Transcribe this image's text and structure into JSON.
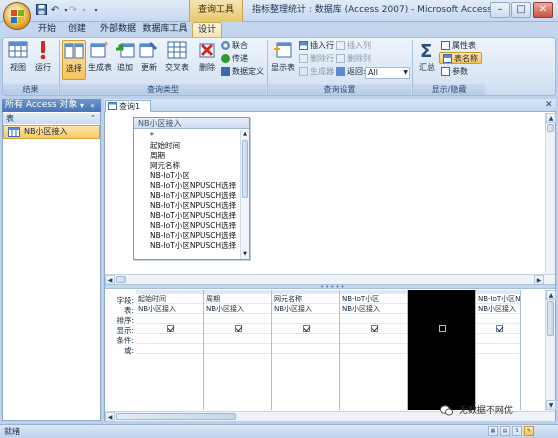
{
  "title_bar": {
    "context_tools": "查询工具",
    "window_title": "指标整理统计 : 数据库 (Access 2007) - Microsoft Access",
    "minimize": "–",
    "maximize": "□",
    "close": "✕"
  },
  "quick_access": {
    "save_icon": "save-icon",
    "undo_icon": "undo-icon",
    "redo_icon": "redo-icon"
  },
  "tabs": [
    {
      "label": "开始"
    },
    {
      "label": "创建"
    },
    {
      "label": "外部数据"
    },
    {
      "label": "数据库工具"
    },
    {
      "label": "设计"
    }
  ],
  "ribbon": {
    "groups": {
      "results": "结果",
      "query_type": "查询类型",
      "query_setup": "查询设置",
      "show_hide": "显示/隐藏"
    },
    "buttons": {
      "view": "视图",
      "run": "运行",
      "select": "选择",
      "make_table": "生成表",
      "append": "追加",
      "update": "更新",
      "crosstab": "交叉表",
      "delete": "删除",
      "union": "联合",
      "pass_through": "传递",
      "data_definition": "数据定义",
      "show_table": "显示表",
      "insert_rows": "插入行",
      "delete_rows": "删除行",
      "builder": "生成器",
      "insert_columns": "插入列",
      "delete_columns": "删除列",
      "return_label": "返回:",
      "return_value": "All",
      "totals": "汇总",
      "property_sheet": "属性表",
      "table_names": "表名称",
      "parameters": "参数"
    }
  },
  "nav_pane": {
    "header": "所有 Access 对象",
    "section": "表",
    "items": [
      {
        "label": "NB小区接入"
      }
    ]
  },
  "document": {
    "tab_label": "查询1",
    "field_list": {
      "title": "NB小区接入",
      "fields": [
        "*",
        "起始时间",
        "周期",
        "网元名称",
        "NB-IoT小区",
        "NB-IoT小区NPUSCH选择",
        "NB-IoT小区NPUSCH选择",
        "NB-IoT小区NPUSCH选择",
        "NB-IoT小区NPUSCH选择",
        "NB-IoT小区NPUSCH选择",
        "NB-IoT小区NPUSCH选择",
        "NB-IoT小区NPUSCH选择"
      ]
    },
    "grid": {
      "row_labels": [
        "字段:",
        "表:",
        "排序:",
        "显示:",
        "条件:",
        "或:"
      ],
      "columns": [
        {
          "field": "起始时间",
          "table": "NB小区接入",
          "show": true
        },
        {
          "field": "周期",
          "table": "NB小区接入",
          "show": true
        },
        {
          "field": "网元名称",
          "table": "NB小区接入",
          "show": true
        },
        {
          "field": "NB-IoT小区",
          "table": "NB小区接入",
          "show": true
        },
        {
          "field": "",
          "table": "",
          "show": false
        },
        {
          "field": "NB-IoT小区NPUSCH选",
          "table": "NB小区接入",
          "show": true
        }
      ]
    }
  },
  "watermark": "无数据不网优",
  "status_bar": {
    "text": "就绪"
  }
}
